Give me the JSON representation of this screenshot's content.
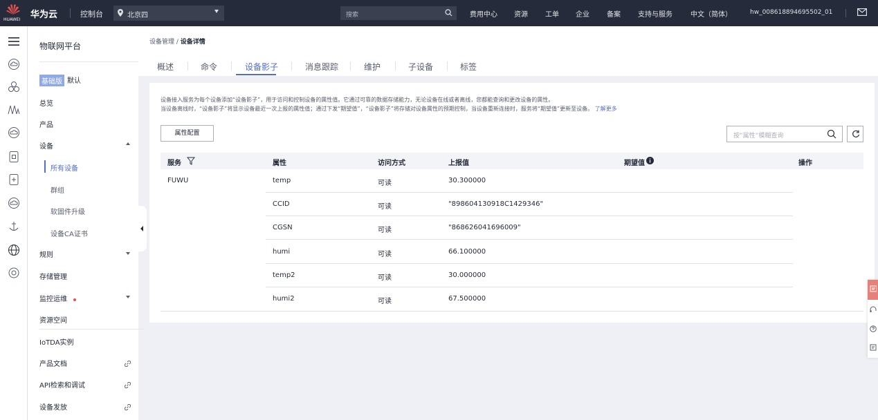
{
  "topbar": {
    "logo_text": "HUAWEI",
    "brand": "华为云",
    "console": "控制台",
    "region": "北京四",
    "search_placeholder": "搜索",
    "nav": [
      "费用中心",
      "资源",
      "工单",
      "企业",
      "备案",
      "支持与服务",
      "中文（简体）",
      "hw_008618894695502_01"
    ]
  },
  "rail_icons": [
    "menu-icon",
    "cloud-icon",
    "cluster-icon",
    "wave-icon",
    "cloud-outline-icon",
    "box-icon",
    "device-icon",
    "cloud-link-icon",
    "anchor-icon",
    "globe-icon",
    "circle-icon"
  ],
  "sidebar": {
    "title": "物联网平台",
    "edition_badge": "基础版",
    "edition_label": "默认",
    "overview": "总览",
    "products": "产品",
    "devices": "设备",
    "device_sub": [
      "所有设备",
      "群组",
      "软固件升级",
      "设备CA证书"
    ],
    "rules": "规则",
    "storage": "存储管理",
    "monitor": "监控运维",
    "resource_space": "资源空间",
    "iotda_instance": "IoTDA实例",
    "product_docs": "产品文档",
    "api_explorer": "API检索和调试",
    "provisioning": "设备发放"
  },
  "header": {
    "breadcrumb_parent": "设备管理",
    "breadcrumb_sep": " / ",
    "breadcrumb_current": "设备详情",
    "tabs": [
      "概述",
      "命令",
      "设备影子",
      "消息跟踪",
      "维护",
      "子设备",
      "标签"
    ],
    "active_tab": "设备影子"
  },
  "content": {
    "desc_line1": "设备接入服务为每个设备添加“设备影子”，用于访问和控制设备的属性值。它通过可靠的数据存储能力，无论设备在线或者离线，您都能查询和更改设备的属性。",
    "desc_line2": "当设备离线时，“设备影子”将显示设备最近一次上报的属性值；通过下发“期望值”，“设备影子”将存储对设备属性的预期控制，当设备重新连接时，服务将“期望值”更新至设备。",
    "learn_more": "了解更多",
    "config_button": "属性配置",
    "filter_placeholder": "按“属性”模糊查询",
    "columns": [
      "服务",
      "属性",
      "访问方式",
      "上报值",
      "期望值",
      "操作"
    ],
    "service_name": "FUWU",
    "rows": [
      {
        "property": "temp",
        "access": "可读",
        "reported": "30.300000"
      },
      {
        "property": "CCID",
        "access": "可读",
        "reported": "\"898604130918C1429346\""
      },
      {
        "property": "CGSN",
        "access": "可读",
        "reported": "\"868626041696009\""
      },
      {
        "property": "humi",
        "access": "可读",
        "reported": "66.100000"
      },
      {
        "property": "temp2",
        "access": "可读",
        "reported": "30.000000"
      },
      {
        "property": "humi2",
        "access": "可读",
        "reported": "67.500000"
      }
    ]
  },
  "colors": {
    "topbar_bg": "#252b3a",
    "accent": "#526ecc",
    "badge": "#8fa8e6",
    "alert": "#e8504e"
  }
}
